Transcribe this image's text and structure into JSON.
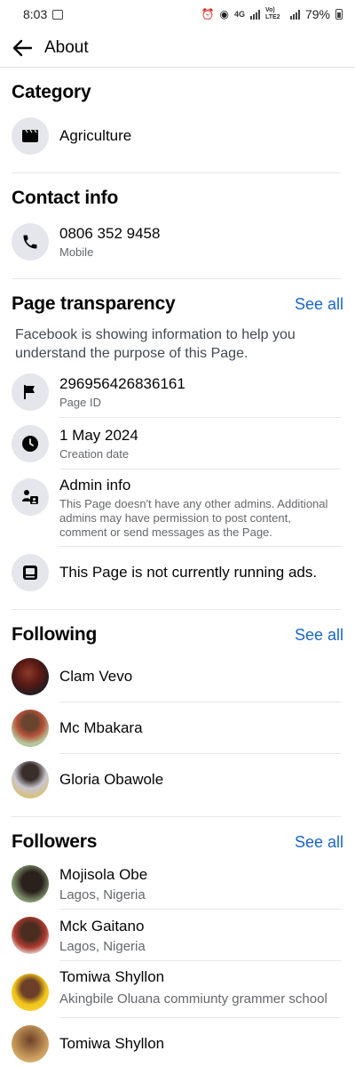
{
  "status_bar": {
    "time": "8:03",
    "network": "4G",
    "volte": "Vo) LTE2",
    "battery": "79%"
  },
  "header": {
    "title": "About"
  },
  "category": {
    "title": "Category",
    "value": "Agriculture"
  },
  "contact": {
    "title": "Contact info",
    "phone": "0806 352 9458",
    "phone_type": "Mobile"
  },
  "transparency": {
    "title": "Page transparency",
    "see_all": "See all",
    "description": "Facebook is showing information to help you understand the purpose of this Page.",
    "page_id": "296956426836161",
    "page_id_label": "Page ID",
    "creation_date": "1 May 2024",
    "creation_label": "Creation date",
    "admin_title": "Admin info",
    "admin_desc": "This Page doesn't have any other admins. Additional admins may have permission to post content, comment or send messages as the Page.",
    "ads_text": "This Page is not currently running ads."
  },
  "following": {
    "title": "Following",
    "see_all": "See all",
    "items": [
      {
        "name": "Clam Vevo"
      },
      {
        "name": "Mc Mbakara"
      },
      {
        "name": "Gloria Obawole"
      }
    ]
  },
  "followers": {
    "title": "Followers",
    "see_all": "See all",
    "items": [
      {
        "name": "Mojisola Obe",
        "location": "Lagos, Nigeria"
      },
      {
        "name": "Mck Gaitano",
        "location": "Lagos, Nigeria"
      },
      {
        "name": "Tomiwa Shyllon",
        "location": "Akingbile Oluana commiunty grammer school"
      },
      {
        "name": "Tomiwa Shyllon"
      }
    ]
  },
  "colors": {
    "link": "#1a66c4",
    "icon_bg": "#e4e6eb",
    "secondary_text": "#65676b"
  }
}
